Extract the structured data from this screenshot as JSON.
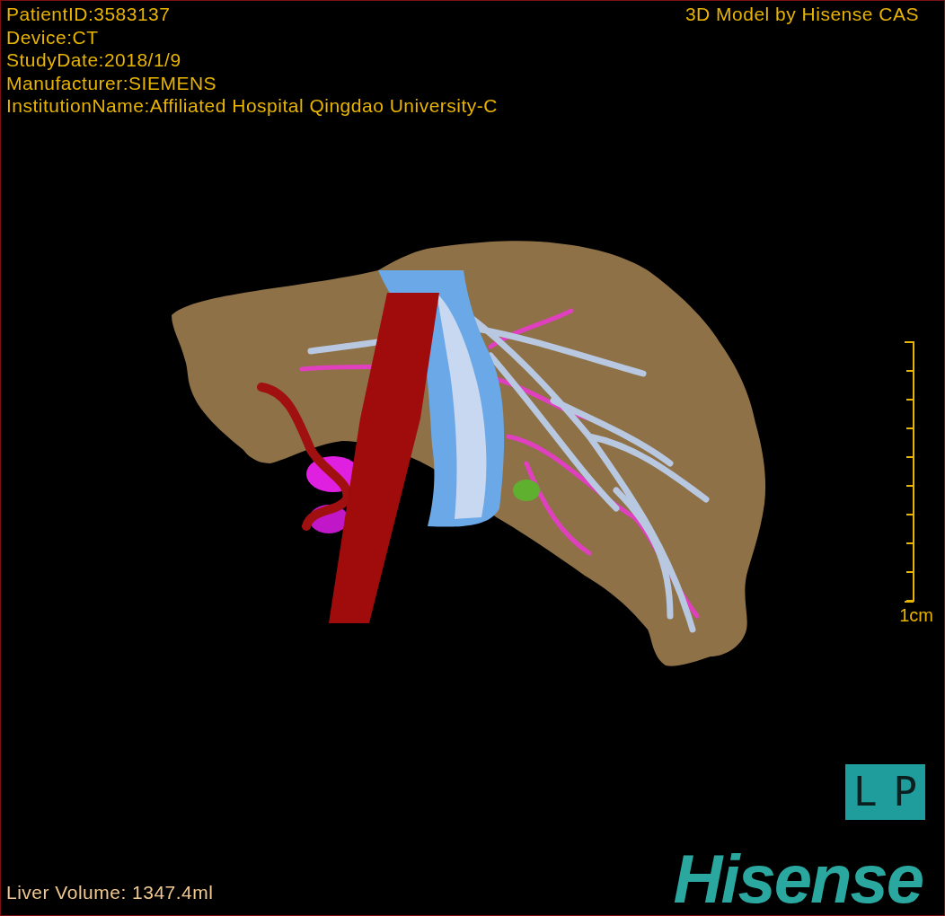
{
  "header": {
    "info": [
      "PatientID:3583137",
      "Device:CT",
      "StudyDate:2018/1/9",
      "Manufacturer:SIEMENS",
      "InstitutionName:Affiliated Hospital Qingdao University-C"
    ],
    "credit": "3D Model by Hisense CAS"
  },
  "scale_bar": {
    "label": "1cm"
  },
  "orientation": {
    "letters": [
      "L",
      "P"
    ]
  },
  "footer": {
    "volume": "Liver Volume: 1347.4ml",
    "logo": "Hisense"
  }
}
